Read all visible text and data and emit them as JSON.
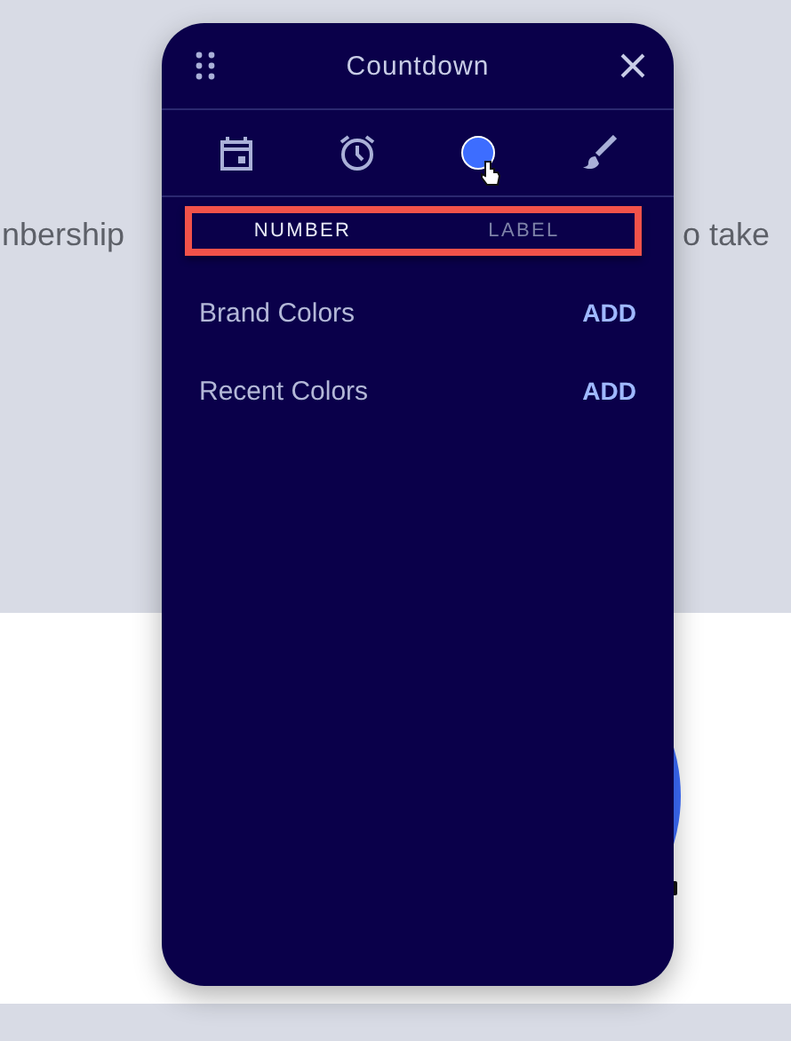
{
  "background": {
    "text_left": "nbership",
    "text_right": "o take"
  },
  "panel": {
    "title": "Countdown",
    "tools": [
      {
        "kind": "calendar",
        "selected": false
      },
      {
        "kind": "alarm",
        "selected": false
      },
      {
        "kind": "color",
        "selected": true,
        "color": "#3d6dff"
      },
      {
        "kind": "brush",
        "selected": false
      }
    ],
    "segments": [
      {
        "label": "NUMBER",
        "selected": true
      },
      {
        "label": "LABEL",
        "selected": false
      }
    ],
    "sections": [
      {
        "label": "Brand Colors",
        "action": "ADD"
      },
      {
        "label": "Recent Colors",
        "action": "ADD"
      }
    ]
  }
}
